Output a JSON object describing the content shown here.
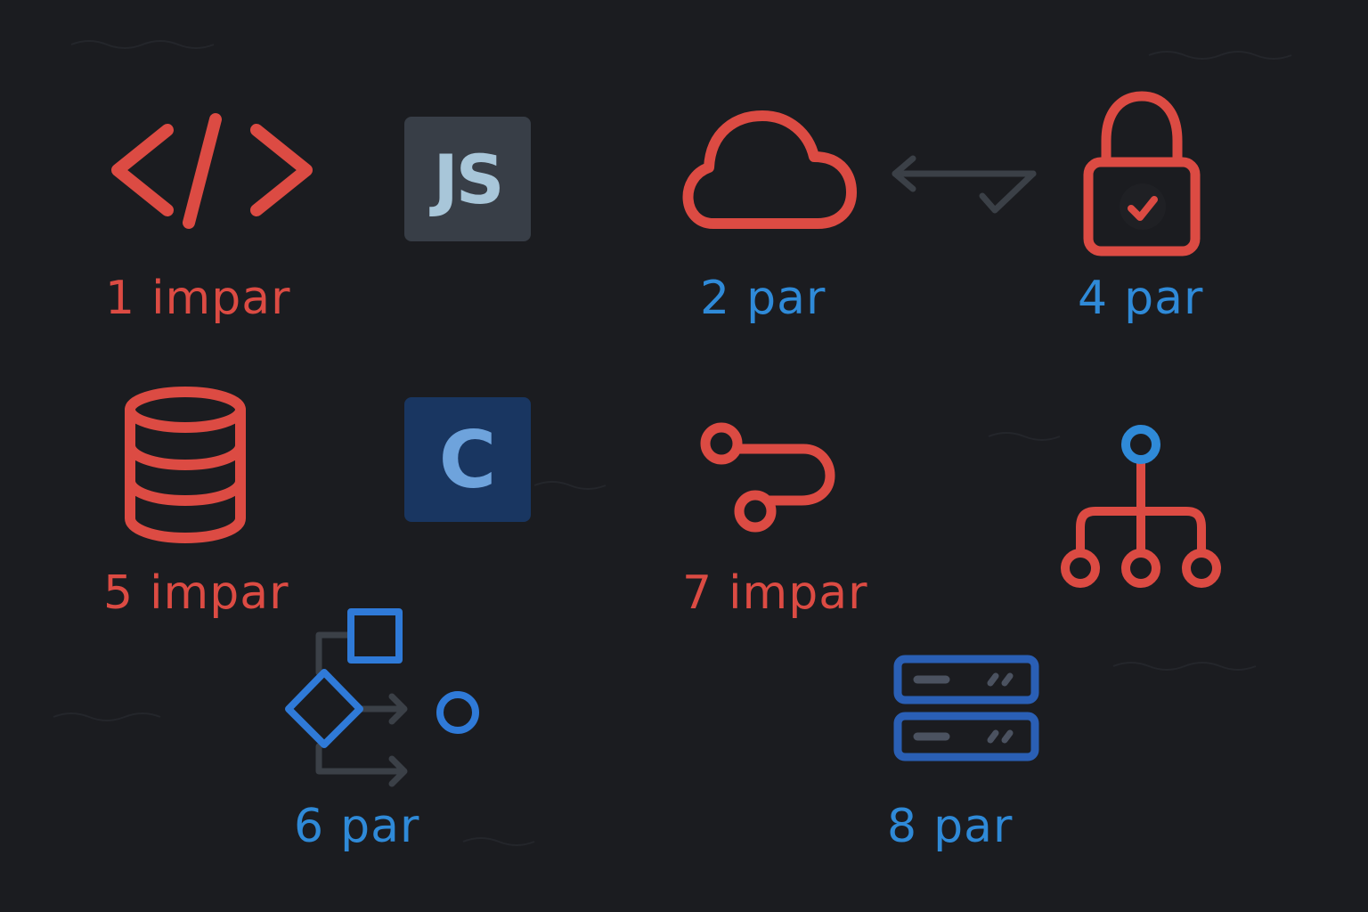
{
  "colors": {
    "background": "#1b1c20",
    "odd": "#dc4b43",
    "even": "#2f8ad8",
    "dim": "#3b4047",
    "js_tile": "#383e47",
    "c_tile": "#193661"
  },
  "items": [
    {
      "icon": "code-brackets-icon",
      "number": "1",
      "word": "impar"
    },
    {
      "icon": "cloud-icon",
      "number": "2",
      "word": "par"
    },
    {
      "icon": "padlock-check-icon",
      "number": "4",
      "word": "par"
    },
    {
      "icon": "database-icon",
      "number": "5",
      "word": "impar"
    },
    {
      "icon": "route-path-icon",
      "number": "7",
      "word": "impar"
    },
    {
      "icon": "flowchart-icon",
      "number": "6",
      "word": "par"
    },
    {
      "icon": "server-rack-icon",
      "number": "8",
      "word": "par"
    }
  ],
  "tiles": {
    "js": {
      "icon": "javascript-logo-icon",
      "text": "JS"
    },
    "c": {
      "icon": "c-language-logo-icon",
      "text": "C"
    }
  },
  "decor": {
    "icon": "sync-arrow-check-icon"
  }
}
